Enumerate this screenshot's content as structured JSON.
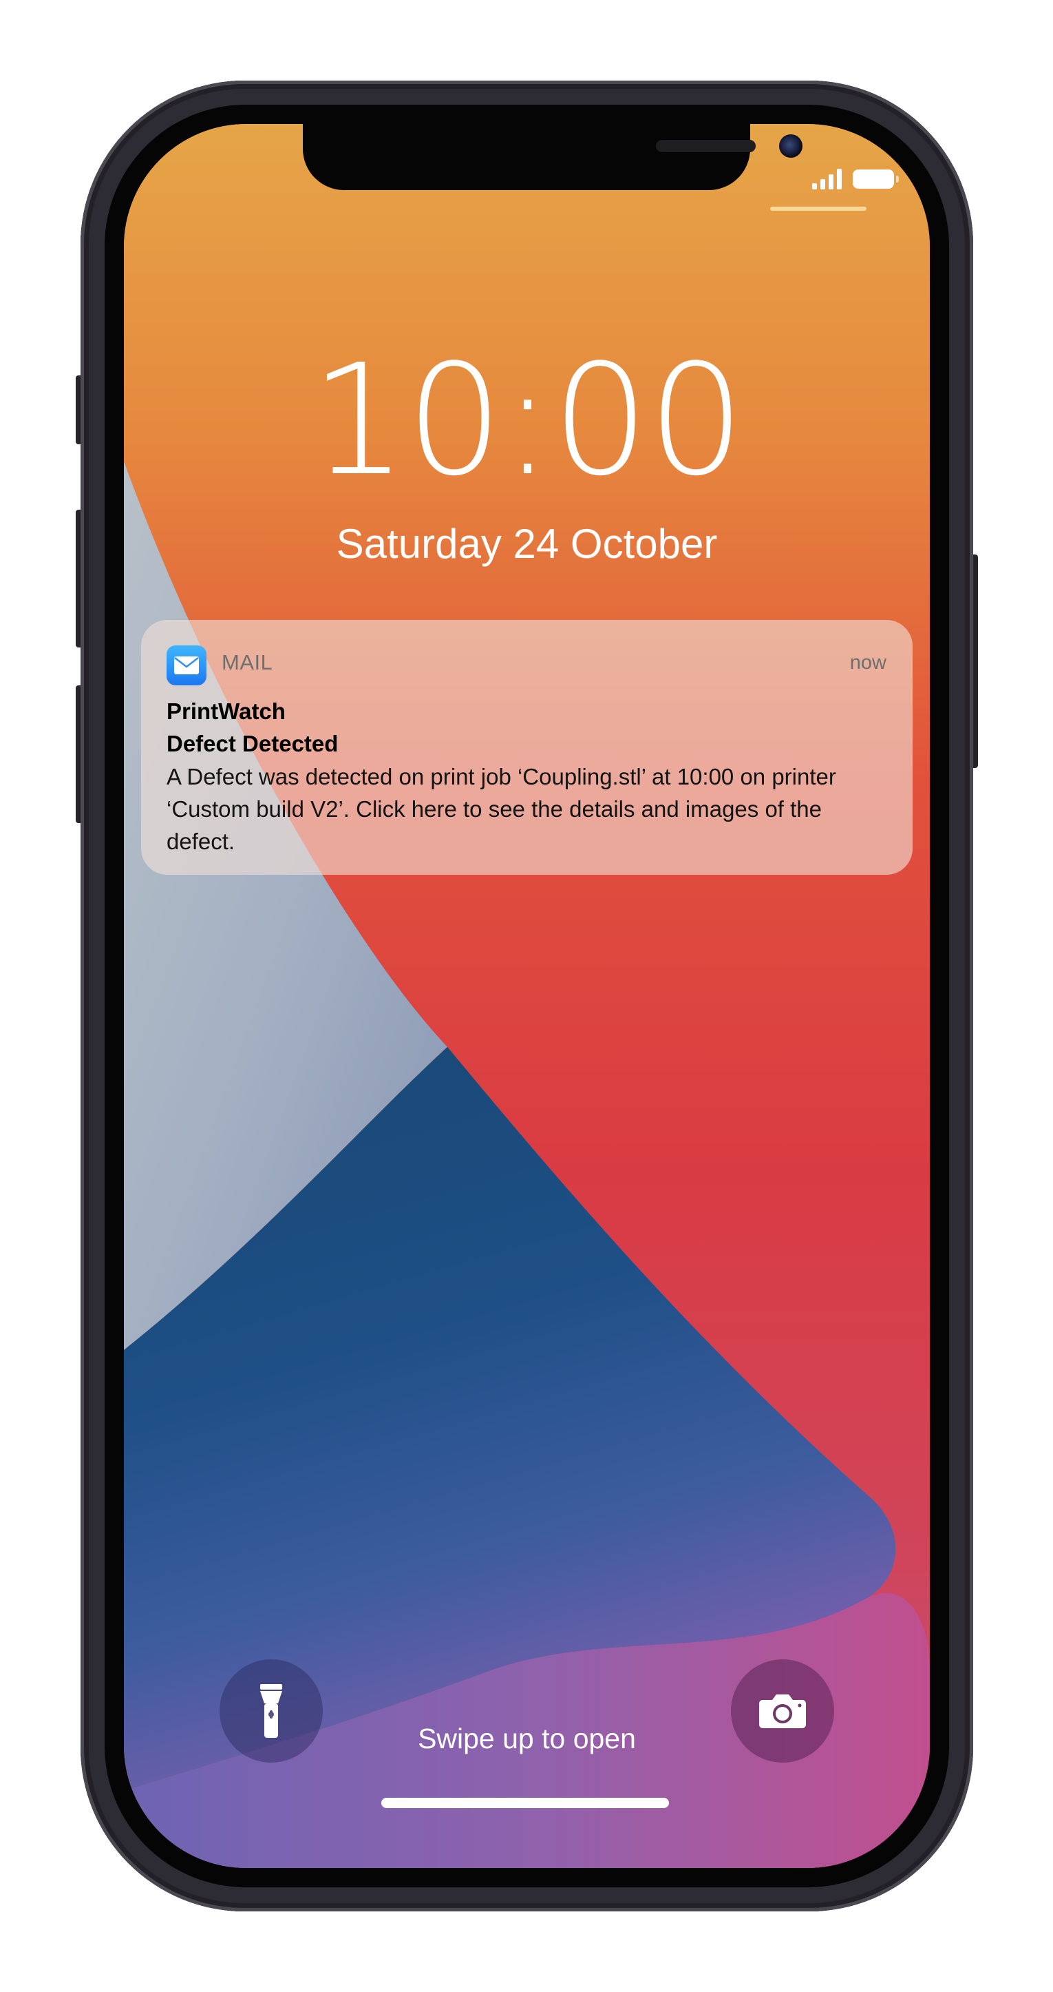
{
  "status_bar": {
    "signal_icon": "cellular-signal-icon",
    "battery_icon": "battery-icon",
    "battery_level": 1.0
  },
  "lock_screen": {
    "time": "10:00",
    "date": "Saturday 24 October"
  },
  "notification": {
    "app_icon": "mail-icon",
    "app_name": "MAIL",
    "timestamp": "now",
    "title": "PrintWatch",
    "subtitle": "Defect Detected",
    "body": "A Defect was detected on print job ‘Coupling.stl’ at 10:00 on printer ‘Custom build V2’. Click here to see the details and images of the defect."
  },
  "quick_actions": {
    "left_icon": "flashlight-icon",
    "right_icon": "camera-icon"
  },
  "swipe_hint": "Swipe up to open",
  "colors": {
    "wallpaper_orange": "#e6843d",
    "wallpaper_red": "#d83c44",
    "wallpaper_blue": "#1f4e7a",
    "wallpaper_gray_blue": "#a9b6c8",
    "mail_blue": "#1d78f0",
    "notification_bg": "#f0ded7"
  }
}
